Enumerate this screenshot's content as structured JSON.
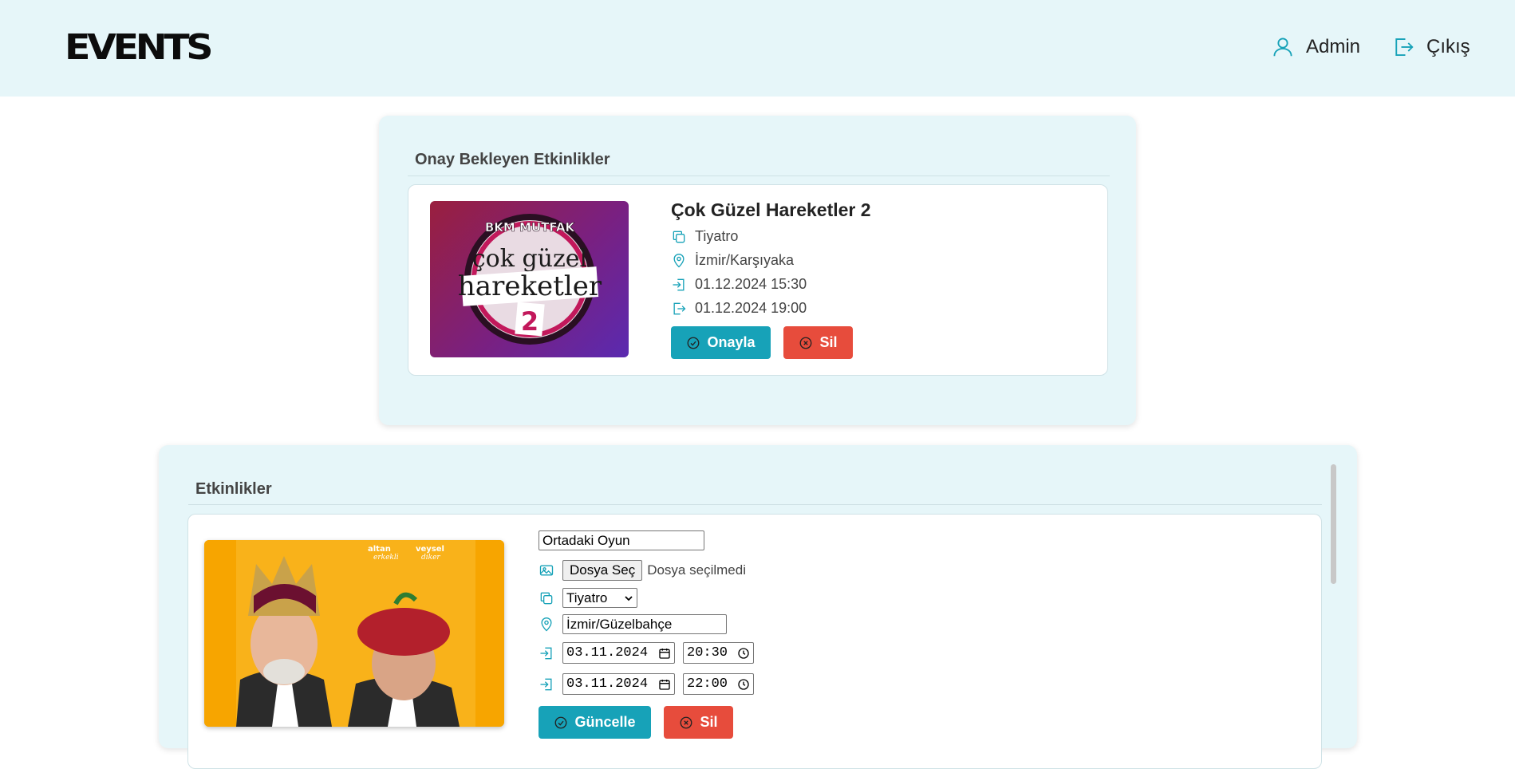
{
  "header": {
    "logo": "EVENTS",
    "admin_label": "Admin",
    "logout_label": "Çıkış"
  },
  "pending": {
    "section_title": "Onay Bekleyen Etkinlikler",
    "event": {
      "title": "Çok Güzel Hareketler 2",
      "category": "Tiyatro",
      "location": "İzmir/Karşıyaka",
      "start": "01.12.2024 15:30",
      "end": "01.12.2024 19:00",
      "poster_top_text": "BKM MUTFAK",
      "poster_line1": "çok güzel",
      "poster_line2": "hareketler",
      "poster_number": "2",
      "approve_label": "Onayla",
      "delete_label": "Sil"
    }
  },
  "events": {
    "section_title": "Etkinlikler",
    "items": [
      {
        "title_value": "Ortadaki Oyun",
        "file_button_label": "Dosya Seç",
        "file_status": "Dosya seçilmedi",
        "category_selected": "Tiyatro",
        "location_value": "İzmir/Güzelbahçe",
        "start_date": "03.11.2024",
        "start_time": "20:30",
        "end_date": "03.11.2024",
        "end_time": "22:00",
        "poster_name1_a": "altan",
        "poster_name1_b": "erkekli",
        "poster_name2_a": "veysel",
        "poster_name2_b": "diker",
        "update_label": "Güncelle",
        "delete_label": "Sil"
      }
    ]
  },
  "colors": {
    "accent": "#17a2b8",
    "danger": "#e74c3c",
    "header_bg": "#e6f6f9",
    "icon": "#17a2b8"
  }
}
